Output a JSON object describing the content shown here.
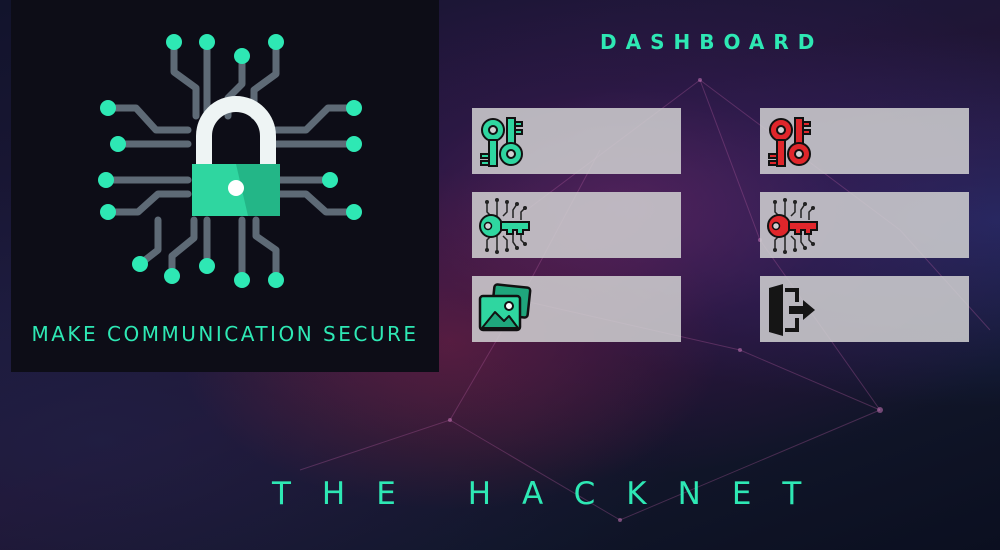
{
  "hero": {
    "tagline": "MAKE COMMUNICATION SECURE",
    "logo_icon": "circuit-lock-icon"
  },
  "dashboard": {
    "title": "DASHBOARD",
    "tiles": [
      {
        "id": "encrypt-keys",
        "icon": "green-keys-icon"
      },
      {
        "id": "decrypt-keys",
        "icon": "red-keys-icon"
      },
      {
        "id": "encrypt-circuit-key",
        "icon": "green-circuit-key-icon"
      },
      {
        "id": "decrypt-circuit-key",
        "icon": "red-circuit-key-icon"
      },
      {
        "id": "images",
        "icon": "images-icon"
      },
      {
        "id": "logout",
        "icon": "logout-icon"
      }
    ]
  },
  "footer": {
    "title": "THE HACKNET"
  },
  "colors": {
    "accent": "#2ee8b4",
    "secure_green": "#2fd6a0",
    "alert_red": "#e0262b",
    "tile_bg": "#d0d0d2"
  }
}
